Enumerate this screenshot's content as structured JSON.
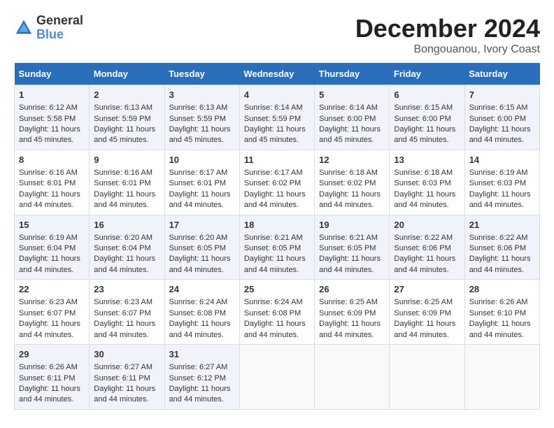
{
  "logo": {
    "text_general": "General",
    "text_blue": "Blue"
  },
  "title": {
    "month_year": "December 2024",
    "location": "Bongouanou, Ivory Coast"
  },
  "calendar": {
    "headers": [
      "Sunday",
      "Monday",
      "Tuesday",
      "Wednesday",
      "Thursday",
      "Friday",
      "Saturday"
    ],
    "weeks": [
      [
        {
          "day": "",
          "sunrise": "",
          "sunset": "",
          "daylight": "",
          "empty": true
        },
        {
          "day": "",
          "sunrise": "",
          "sunset": "",
          "daylight": "",
          "empty": true
        },
        {
          "day": "",
          "sunrise": "",
          "sunset": "",
          "daylight": "",
          "empty": true
        },
        {
          "day": "",
          "sunrise": "",
          "sunset": "",
          "daylight": "",
          "empty": true
        },
        {
          "day": "",
          "sunrise": "",
          "sunset": "",
          "daylight": "",
          "empty": true
        },
        {
          "day": "",
          "sunrise": "",
          "sunset": "",
          "daylight": "",
          "empty": true
        },
        {
          "day": "",
          "sunrise": "",
          "sunset": "",
          "daylight": "",
          "empty": true
        }
      ],
      [
        {
          "day": "1",
          "sunrise": "Sunrise: 6:12 AM",
          "sunset": "Sunset: 5:58 PM",
          "daylight": "Daylight: 11 hours and 45 minutes.",
          "empty": false
        },
        {
          "day": "2",
          "sunrise": "Sunrise: 6:13 AM",
          "sunset": "Sunset: 5:59 PM",
          "daylight": "Daylight: 11 hours and 45 minutes.",
          "empty": false
        },
        {
          "day": "3",
          "sunrise": "Sunrise: 6:13 AM",
          "sunset": "Sunset: 5:59 PM",
          "daylight": "Daylight: 11 hours and 45 minutes.",
          "empty": false
        },
        {
          "day": "4",
          "sunrise": "Sunrise: 6:14 AM",
          "sunset": "Sunset: 5:59 PM",
          "daylight": "Daylight: 11 hours and 45 minutes.",
          "empty": false
        },
        {
          "day": "5",
          "sunrise": "Sunrise: 6:14 AM",
          "sunset": "Sunset: 6:00 PM",
          "daylight": "Daylight: 11 hours and 45 minutes.",
          "empty": false
        },
        {
          "day": "6",
          "sunrise": "Sunrise: 6:15 AM",
          "sunset": "Sunset: 6:00 PM",
          "daylight": "Daylight: 11 hours and 45 minutes.",
          "empty": false
        },
        {
          "day": "7",
          "sunrise": "Sunrise: 6:15 AM",
          "sunset": "Sunset: 6:00 PM",
          "daylight": "Daylight: 11 hours and 44 minutes.",
          "empty": false
        }
      ],
      [
        {
          "day": "8",
          "sunrise": "Sunrise: 6:16 AM",
          "sunset": "Sunset: 6:01 PM",
          "daylight": "Daylight: 11 hours and 44 minutes.",
          "empty": false
        },
        {
          "day": "9",
          "sunrise": "Sunrise: 6:16 AM",
          "sunset": "Sunset: 6:01 PM",
          "daylight": "Daylight: 11 hours and 44 minutes.",
          "empty": false
        },
        {
          "day": "10",
          "sunrise": "Sunrise: 6:17 AM",
          "sunset": "Sunset: 6:01 PM",
          "daylight": "Daylight: 11 hours and 44 minutes.",
          "empty": false
        },
        {
          "day": "11",
          "sunrise": "Sunrise: 6:17 AM",
          "sunset": "Sunset: 6:02 PM",
          "daylight": "Daylight: 11 hours and 44 minutes.",
          "empty": false
        },
        {
          "day": "12",
          "sunrise": "Sunrise: 6:18 AM",
          "sunset": "Sunset: 6:02 PM",
          "daylight": "Daylight: 11 hours and 44 minutes.",
          "empty": false
        },
        {
          "day": "13",
          "sunrise": "Sunrise: 6:18 AM",
          "sunset": "Sunset: 6:03 PM",
          "daylight": "Daylight: 11 hours and 44 minutes.",
          "empty": false
        },
        {
          "day": "14",
          "sunrise": "Sunrise: 6:19 AM",
          "sunset": "Sunset: 6:03 PM",
          "daylight": "Daylight: 11 hours and 44 minutes.",
          "empty": false
        }
      ],
      [
        {
          "day": "15",
          "sunrise": "Sunrise: 6:19 AM",
          "sunset": "Sunset: 6:04 PM",
          "daylight": "Daylight: 11 hours and 44 minutes.",
          "empty": false
        },
        {
          "day": "16",
          "sunrise": "Sunrise: 6:20 AM",
          "sunset": "Sunset: 6:04 PM",
          "daylight": "Daylight: 11 hours and 44 minutes.",
          "empty": false
        },
        {
          "day": "17",
          "sunrise": "Sunrise: 6:20 AM",
          "sunset": "Sunset: 6:05 PM",
          "daylight": "Daylight: 11 hours and 44 minutes.",
          "empty": false
        },
        {
          "day": "18",
          "sunrise": "Sunrise: 6:21 AM",
          "sunset": "Sunset: 6:05 PM",
          "daylight": "Daylight: 11 hours and 44 minutes.",
          "empty": false
        },
        {
          "day": "19",
          "sunrise": "Sunrise: 6:21 AM",
          "sunset": "Sunset: 6:05 PM",
          "daylight": "Daylight: 11 hours and 44 minutes.",
          "empty": false
        },
        {
          "day": "20",
          "sunrise": "Sunrise: 6:22 AM",
          "sunset": "Sunset: 6:06 PM",
          "daylight": "Daylight: 11 hours and 44 minutes.",
          "empty": false
        },
        {
          "day": "21",
          "sunrise": "Sunrise: 6:22 AM",
          "sunset": "Sunset: 6:06 PM",
          "daylight": "Daylight: 11 hours and 44 minutes.",
          "empty": false
        }
      ],
      [
        {
          "day": "22",
          "sunrise": "Sunrise: 6:23 AM",
          "sunset": "Sunset: 6:07 PM",
          "daylight": "Daylight: 11 hours and 44 minutes.",
          "empty": false
        },
        {
          "day": "23",
          "sunrise": "Sunrise: 6:23 AM",
          "sunset": "Sunset: 6:07 PM",
          "daylight": "Daylight: 11 hours and 44 minutes.",
          "empty": false
        },
        {
          "day": "24",
          "sunrise": "Sunrise: 6:24 AM",
          "sunset": "Sunset: 6:08 PM",
          "daylight": "Daylight: 11 hours and 44 minutes.",
          "empty": false
        },
        {
          "day": "25",
          "sunrise": "Sunrise: 6:24 AM",
          "sunset": "Sunset: 6:08 PM",
          "daylight": "Daylight: 11 hours and 44 minutes.",
          "empty": false
        },
        {
          "day": "26",
          "sunrise": "Sunrise: 6:25 AM",
          "sunset": "Sunset: 6:09 PM",
          "daylight": "Daylight: 11 hours and 44 minutes.",
          "empty": false
        },
        {
          "day": "27",
          "sunrise": "Sunrise: 6:25 AM",
          "sunset": "Sunset: 6:09 PM",
          "daylight": "Daylight: 11 hours and 44 minutes.",
          "empty": false
        },
        {
          "day": "28",
          "sunrise": "Sunrise: 6:26 AM",
          "sunset": "Sunset: 6:10 PM",
          "daylight": "Daylight: 11 hours and 44 minutes.",
          "empty": false
        }
      ],
      [
        {
          "day": "29",
          "sunrise": "Sunrise: 6:26 AM",
          "sunset": "Sunset: 6:11 PM",
          "daylight": "Daylight: 11 hours and 44 minutes.",
          "empty": false
        },
        {
          "day": "30",
          "sunrise": "Sunrise: 6:27 AM",
          "sunset": "Sunset: 6:11 PM",
          "daylight": "Daylight: 11 hours and 44 minutes.",
          "empty": false
        },
        {
          "day": "31",
          "sunrise": "Sunrise: 6:27 AM",
          "sunset": "Sunset: 6:12 PM",
          "daylight": "Daylight: 11 hours and 44 minutes.",
          "empty": false
        },
        {
          "day": "",
          "sunrise": "",
          "sunset": "",
          "daylight": "",
          "empty": true
        },
        {
          "day": "",
          "sunrise": "",
          "sunset": "",
          "daylight": "",
          "empty": true
        },
        {
          "day": "",
          "sunrise": "",
          "sunset": "",
          "daylight": "",
          "empty": true
        },
        {
          "day": "",
          "sunrise": "",
          "sunset": "",
          "daylight": "",
          "empty": true
        }
      ]
    ]
  }
}
